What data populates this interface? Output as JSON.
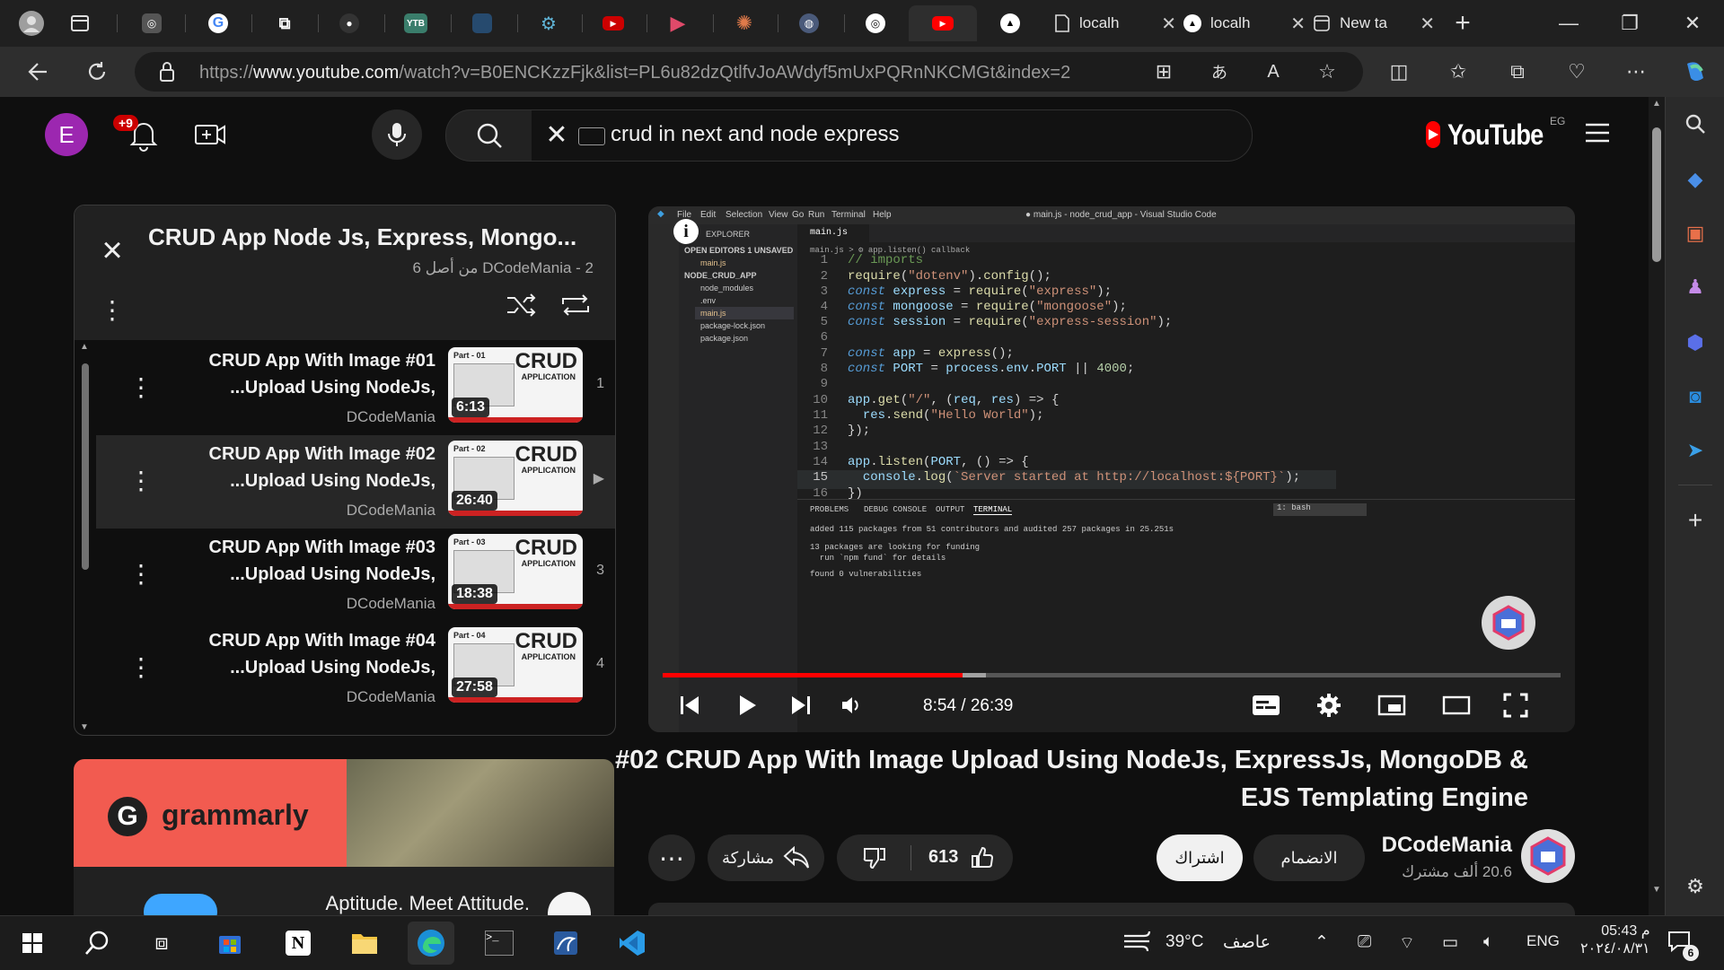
{
  "browser": {
    "tabs": [
      {
        "icon": "profile-avatar-icon"
      },
      {
        "icon": "tab-actions-icon"
      },
      {
        "icon": "chatgpt-icon"
      },
      {
        "icon": "google-icon"
      },
      {
        "icon": "extension-icon"
      },
      {
        "icon": "github-icon"
      },
      {
        "icon": "ytb-icon",
        "text": "YTB"
      },
      {
        "icon": "document-icon"
      },
      {
        "icon": "gear-tab-icon"
      },
      {
        "icon": "youtube-red-icon"
      },
      {
        "icon": "play-tab-icon"
      },
      {
        "icon": "claude-icon"
      },
      {
        "icon": "globe-tab-icon"
      },
      {
        "icon": "chatgpt-icon-2"
      },
      {
        "icon": "youtube-active-icon"
      },
      {
        "icon": "vercel-icon"
      }
    ],
    "wide_tabs": [
      {
        "label": "localh",
        "close": "✕"
      },
      {
        "label": "localh",
        "close": "✕"
      },
      {
        "label": "New ta",
        "close": "✕"
      }
    ],
    "new_tab": "+",
    "url_prefix": "https://",
    "url_host": "www.youtube.com",
    "url_path": "/watch?v=B0ENCKzzFjk&list=PL6u82dzQtlfvJoAWdyf5mUxPQRnNKCMGt&index=2"
  },
  "masthead": {
    "avatar_letter": "E",
    "notification_count": "+9",
    "search_query": "crud in next and node express",
    "logo_text": "YouTube",
    "region": "EG"
  },
  "playlist": {
    "title": "CRUD App Node Js, Express, Mongo...",
    "subtitle": "DCodeMania - 2 من أصل 6",
    "items": [
      {
        "line1": "CRUD App With Image #01",
        "line2": "...Upload Using NodeJs,",
        "channel": "DCodeMania",
        "duration": "6:13",
        "index": "1",
        "part": "Part - 01"
      },
      {
        "line1": "CRUD App With Image #02",
        "line2": "...Upload Using NodeJs,",
        "channel": "DCodeMania",
        "duration": "26:40",
        "index": "▶",
        "part": "Part - 02"
      },
      {
        "line1": "CRUD App With Image #03",
        "line2": "...Upload Using NodeJs,",
        "channel": "DCodeMania",
        "duration": "18:38",
        "index": "3",
        "part": "Part - 03"
      },
      {
        "line1": "CRUD App With Image #04",
        "line2": "...Upload Using NodeJs,",
        "channel": "DCodeMania",
        "duration": "27:58",
        "index": "4",
        "part": "Part - 04"
      }
    ],
    "thumb_crud": "CRUD",
    "thumb_app": "APPLICATION"
  },
  "ad": {
    "brand": "grammarly",
    "logo_letter": "G",
    "headline": "Aptitude. Meet Attitude."
  },
  "player": {
    "time_current": "8:54",
    "time_total": "26:39",
    "progress_fraction": 0.334,
    "buffer_fraction": 0.36,
    "vscode": {
      "menu": [
        "File",
        "Edit",
        "Selection",
        "View",
        "Go",
        "Run",
        "Terminal",
        "Help"
      ],
      "window_title": "● main.js - node_crud_app - Visual Studio Code",
      "tab": "main.js",
      "breadcrumb": "main.js > ⚙ app.listen() callback",
      "explorer": [
        "EXPLORER",
        "OPEN EDITORS 1 UNSAVED",
        "main.js",
        "NODE_CRUD_APP",
        "node_modules",
        ".env",
        "main.js",
        "package-lock.json",
        "package.json"
      ],
      "terminal_tabs": [
        "PROBLEMS",
        "DEBUG CONSOLE",
        "OUTPUT",
        "TERMINAL"
      ],
      "terminal_select": "1: bash",
      "terminal_lines": [
        "added 115 packages from 51 contributors and audited 257 packages in 25.251s",
        "",
        "13 packages are looking for funding",
        "  run `npm fund` for details",
        "",
        "found 0 vulnerabilities"
      ]
    }
  },
  "video": {
    "title_line1": "#02 CRUD App With Image Upload Using NodeJs, ExpressJs, MongoDB &",
    "title_line2": "EJS Templating Engine",
    "channel": "DCodeMania",
    "subscribers": "20.6 ألف مشترك",
    "join_label": "الانضمام",
    "subscribe_label": "اشتراك",
    "likes": "613",
    "share_label": "مشاركة",
    "more": "⋯"
  },
  "taskbar": {
    "weather_temp": "39°C",
    "weather_label": "عاصف",
    "lang": "ENG",
    "time": "05:43 م",
    "date": "٢٠٢٤/٠٨/٣١",
    "notifications": "6"
  },
  "colors": {
    "youtube_red": "#ff0000",
    "avatar_purple": "#9c27b0",
    "grammarly_red": "#f25b50",
    "edge_blue": "#3ea6ff"
  }
}
